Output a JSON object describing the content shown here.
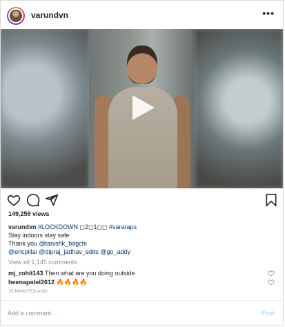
{
  "post": {
    "username": "varundvn",
    "more_label": "•••",
    "views": "149,259 views",
    "caption": {
      "user": "varundvn",
      "hashtag": "#LOCKDOWN",
      "symbols": " ◻2◻1◻◻ ",
      "hashtag2": "#vararaps",
      "line2": "Stay indoors stay safe",
      "line3_prefix": "Thank you ",
      "line3_mention": "@tanishk_bagchi",
      "line4_m1": "@ericpillai",
      "line4_m2": "@dipraj_jadhav_edits",
      "line4_m3": "@go_addy"
    },
    "view_all": "View all 1,145 comments",
    "comments": [
      {
        "user": "mj_rohit143",
        "text": "Then what are you doing outside"
      },
      {
        "user": "heenapatel2612",
        "text": "🔥🔥🔥🔥"
      }
    ],
    "timestamp": "15 MINUTES AGO",
    "add_comment_placeholder": "Add a comment…",
    "post_label": "Post"
  },
  "icons": [
    "avatar",
    "more-options-icon",
    "play-icon",
    "heart-icon",
    "comment-icon",
    "share-icon",
    "bookmark-icon",
    "small-heart-icon"
  ]
}
